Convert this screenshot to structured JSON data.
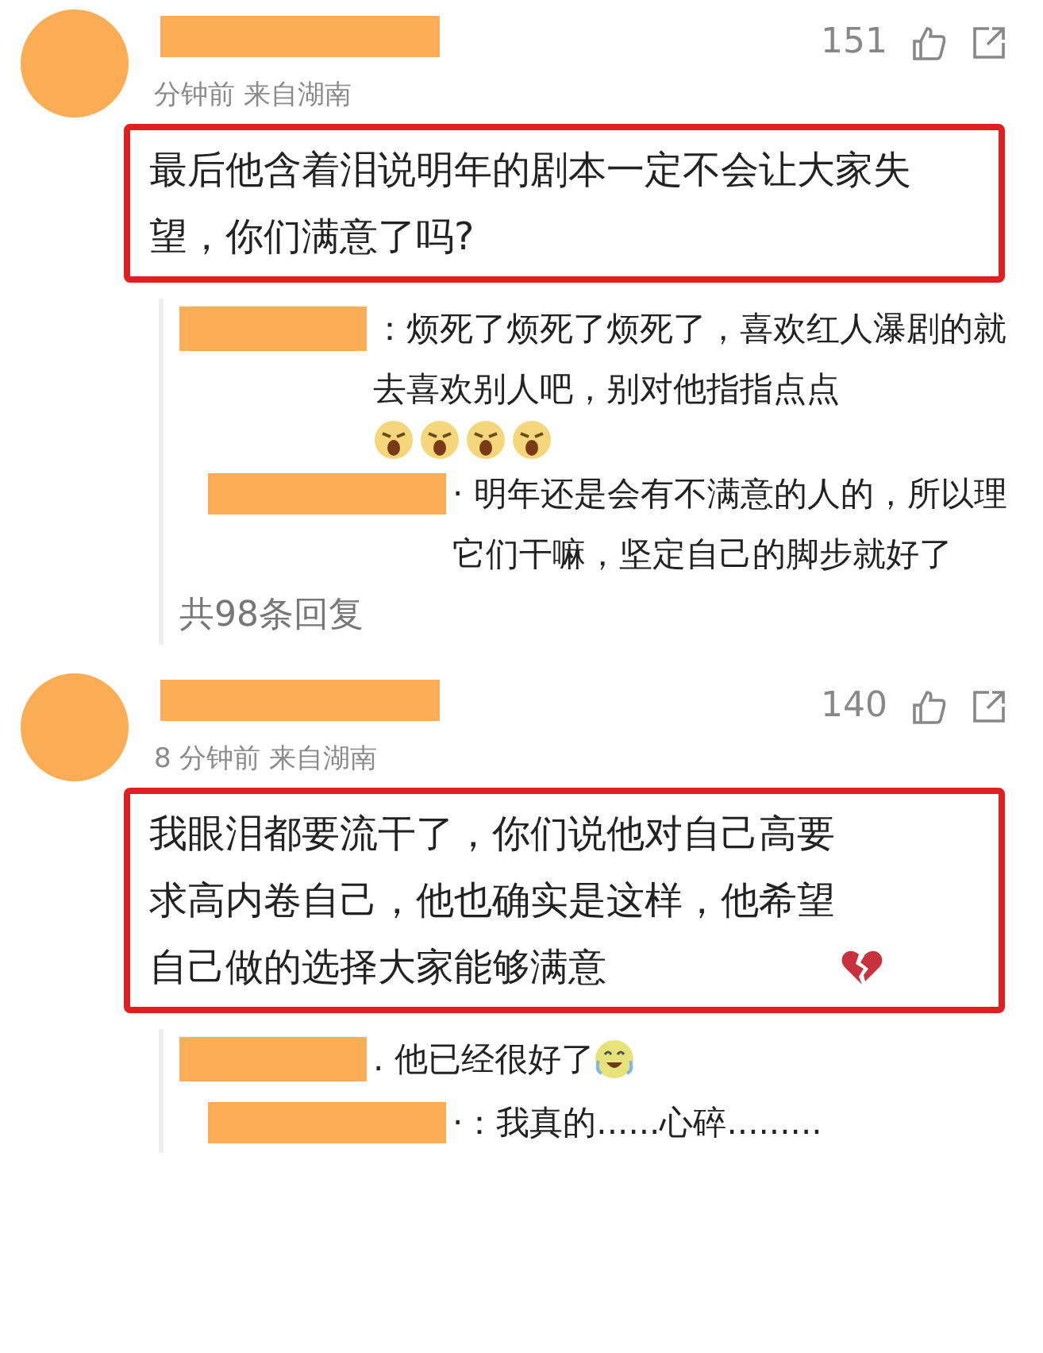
{
  "comments": [
    {
      "meta": "分钟前  来自湖南",
      "likes": "151",
      "content": "最后他含着泪说明年的剧本一定不会让大家失望，你们满意了吗?",
      "replies": [
        {
          "text": "：烦死了烦死了烦死了，喜欢红人瀑剧的就去喜欢别人吧，别对他指指点点",
          "emoji": [
            {
              "kind": "angry"
            },
            {
              "kind": "angry"
            },
            {
              "kind": "angry"
            },
            {
              "kind": "angry"
            }
          ]
        },
        {
          "text": "· 明年还是会有不满意的人的，所以理它们干嘛，坚定自己的脚步就好了"
        }
      ],
      "more": "共98条回复"
    },
    {
      "meta": "8 分钟前  来自湖南",
      "likes": "140",
      "content": "我眼泪都要流干了，你们说他对自己高要求高内卷自己，他也确实是这样，他希望自己做的选择大家能够满意",
      "content_emoji": [
        {
          "kind": "broken_heart"
        }
      ],
      "replies": [
        {
          "text": ". 他已经很好了",
          "emoji": [
            {
              "kind": "laugh_cry"
            }
          ]
        },
        {
          "text": "·：我真的......心碎........."
        }
      ]
    }
  ]
}
